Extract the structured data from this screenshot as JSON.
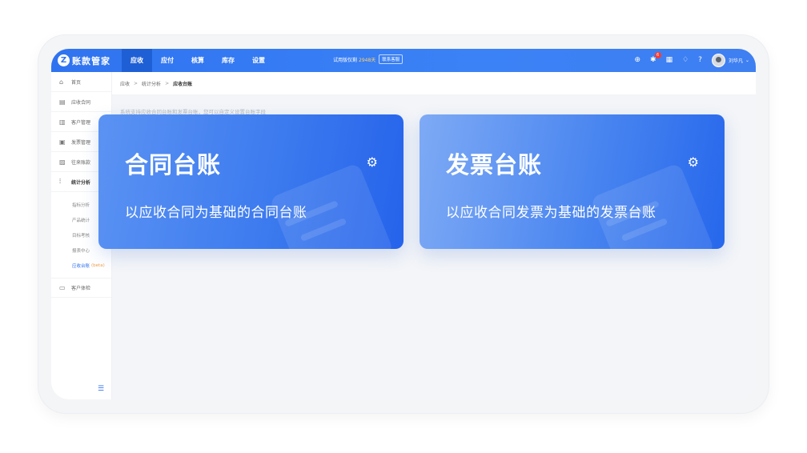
{
  "app": {
    "logo_letter": "Z",
    "name": "账款管家"
  },
  "nav": [
    {
      "label": "应收",
      "active": true
    },
    {
      "label": "应付"
    },
    {
      "label": "核算"
    },
    {
      "label": "库存"
    },
    {
      "label": "设置"
    }
  ],
  "trial": {
    "prefix": "试用版仅剩",
    "days": "2948天",
    "contact": "联系客服"
  },
  "topbar": {
    "notification_count": "6",
    "user_name": "刘华凡"
  },
  "sidebar": {
    "items": [
      {
        "label": "首页",
        "icon": "home-icon"
      },
      {
        "label": "应收合同",
        "icon": "contract-icon"
      },
      {
        "label": "客户管理",
        "icon": "customer-icon"
      },
      {
        "label": "发票管理",
        "icon": "invoice-icon"
      },
      {
        "label": "往来账款",
        "icon": "account-icon"
      },
      {
        "label": "统计分析",
        "icon": "chart-icon",
        "active": true
      }
    ],
    "sub_items": [
      {
        "label": "指标分析"
      },
      {
        "label": "产品统计"
      },
      {
        "label": "目标考核"
      },
      {
        "label": "报表中心"
      },
      {
        "label": "应收台账",
        "tag": "(beta)",
        "active": true
      }
    ],
    "last_item": {
      "label": "客户体检",
      "icon": "checkup-icon"
    }
  },
  "breadcrumb": {
    "items": [
      "应收",
      "统计分析",
      "应收台账"
    ],
    "separator": ">"
  },
  "description": "系统支持应收合同台账和发票台账，您可以自定义设置台账字段",
  "cards": [
    {
      "title": "合同台账",
      "subtitle": "以应收合同为基础的合同台账"
    },
    {
      "title": "发票台账",
      "subtitle": "以应收合同发票为基础的发票台账"
    }
  ],
  "colors": {
    "primary": "#2f73f0",
    "badge": "#ff3b30",
    "trial_days": "#ffd36b"
  }
}
